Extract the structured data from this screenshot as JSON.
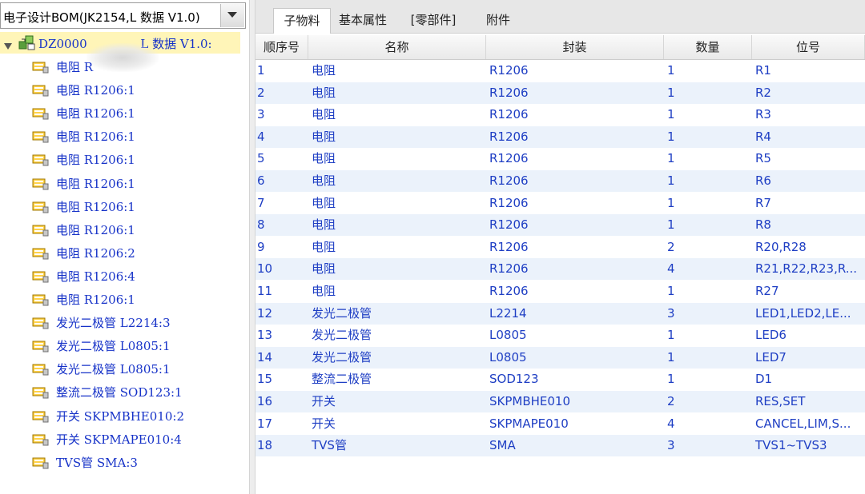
{
  "bom_select": {
    "value": "电子设计BOM(JK2154,L 数据 V1.0)"
  },
  "tree": {
    "root_label": "DZ0000              L 数据 V1.0:",
    "items": [
      "电阻 R",
      "电阻 R1206:1",
      "电阻 R1206:1",
      "电阻 R1206:1",
      "电阻 R1206:1",
      "电阻 R1206:1",
      "电阻 R1206:1",
      "电阻 R1206:1",
      "电阻 R1206:2",
      "电阻 R1206:4",
      "电阻 R1206:1",
      "发光二极管 L2214:3",
      "发光二极管 L0805:1",
      "发光二极管 L0805:1",
      "整流二极管 SOD123:1",
      "开关 SKPMBHE010:2",
      "开关 SKPMAPE010:4",
      "TVS管 SMA:3"
    ]
  },
  "tabs": [
    "子物料",
    "基本属性",
    "[零部件]",
    "附件"
  ],
  "active_tab": 0,
  "table": {
    "columns": [
      "顺序号",
      "名称",
      "封装",
      "数量",
      "位号"
    ],
    "rows": [
      [
        "1",
        "电阻",
        "R1206",
        "1",
        "R1"
      ],
      [
        "2",
        "电阻",
        "R1206",
        "1",
        "R2"
      ],
      [
        "3",
        "电阻",
        "R1206",
        "1",
        "R3"
      ],
      [
        "4",
        "电阻",
        "R1206",
        "1",
        "R4"
      ],
      [
        "5",
        "电阻",
        "R1206",
        "1",
        "R5"
      ],
      [
        "6",
        "电阻",
        "R1206",
        "1",
        "R6"
      ],
      [
        "7",
        "电阻",
        "R1206",
        "1",
        "R7"
      ],
      [
        "8",
        "电阻",
        "R1206",
        "1",
        "R8"
      ],
      [
        "9",
        "电阻",
        "R1206",
        "2",
        "R20,R28"
      ],
      [
        "10",
        "电阻",
        "R1206",
        "4",
        "R21,R22,R23,R..."
      ],
      [
        "11",
        "电阻",
        "R1206",
        "1",
        "R27"
      ],
      [
        "12",
        "发光二极管",
        "L2214",
        "3",
        "LED1,LED2,LE..."
      ],
      [
        "13",
        "发光二极管",
        "L0805",
        "1",
        "LED6"
      ],
      [
        "14",
        "发光二极管",
        "L0805",
        "1",
        "LED7"
      ],
      [
        "15",
        "整流二极管",
        "SOD123",
        "1",
        "D1"
      ],
      [
        "16",
        "开关",
        "SKPMBHE010",
        "2",
        "RES,SET"
      ],
      [
        "17",
        "开关",
        "SKPMAPE010",
        "4",
        "CANCEL,LIM,S..."
      ],
      [
        "18",
        "TVS管",
        "SMA",
        "3",
        "TVS1~TVS3"
      ]
    ]
  },
  "colors": {
    "link_text": "#1f3fc4",
    "row_alt": "#ebf2fb",
    "tree_selected": "#fff5b8"
  }
}
